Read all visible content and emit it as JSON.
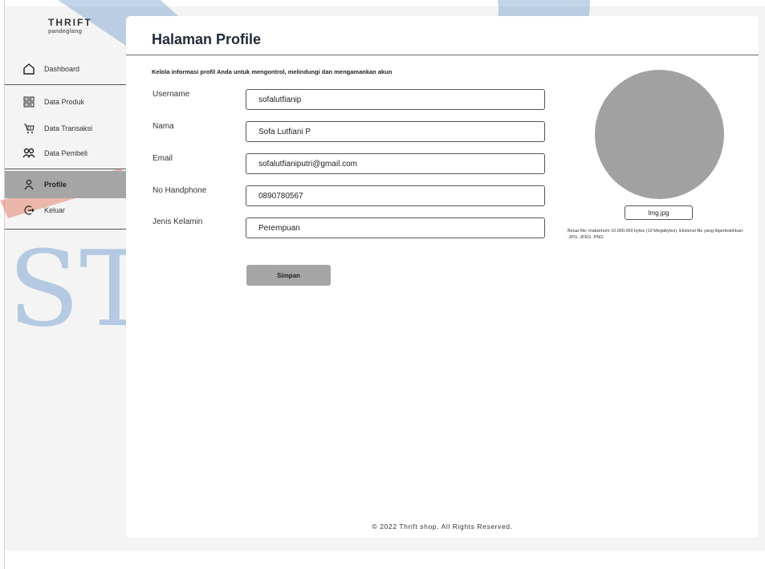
{
  "brand": {
    "name": "THRIFT",
    "sub": "pandeglang"
  },
  "sidebar": {
    "items": [
      {
        "label": "Dashboard",
        "icon": "home-icon"
      },
      {
        "label": "Data Produk",
        "icon": "barcode-icon"
      },
      {
        "label": "Data Transaksi",
        "icon": "cart-icon"
      },
      {
        "label": "Data Pembeli",
        "icon": "users-icon"
      },
      {
        "label": "Profile",
        "icon": "user-icon",
        "active": true
      },
      {
        "label": "Keluar",
        "icon": "logout-icon"
      }
    ]
  },
  "page": {
    "title": "Halaman Profile",
    "subtitle": "Kelola informasi profil Anda untuk mengontrol, melindungi dan mengamankan akun"
  },
  "form": {
    "fields": [
      {
        "label": "Username",
        "value": "sofalutfianip"
      },
      {
        "label": "Nama",
        "value": "Sofa Lutfiani P"
      },
      {
        "label": "Email",
        "value": "sofalutfianiputri@gmail.com"
      },
      {
        "label": "No Handphone",
        "value": "0890780567"
      },
      {
        "label": "Jenis Kelamin",
        "value": "Perempuan"
      }
    ],
    "save_label": "Simpan"
  },
  "photo": {
    "file_label": "Img.jpg",
    "note": "Besar file: maksimum 10.000.000 bytes (10 Megabytes). Ekstensi file yang diperbolehkan: .JPG .JPEG .PNG"
  },
  "footer": {
    "text": "© 2022 Thrift shop. All Rights Reserved."
  },
  "watermark": {
    "text": "STT - NF"
  },
  "colors": {
    "active_nav": "#a5a5a5",
    "watermark": "#5b8fc7",
    "accent_stripe": "#e07a5f"
  }
}
